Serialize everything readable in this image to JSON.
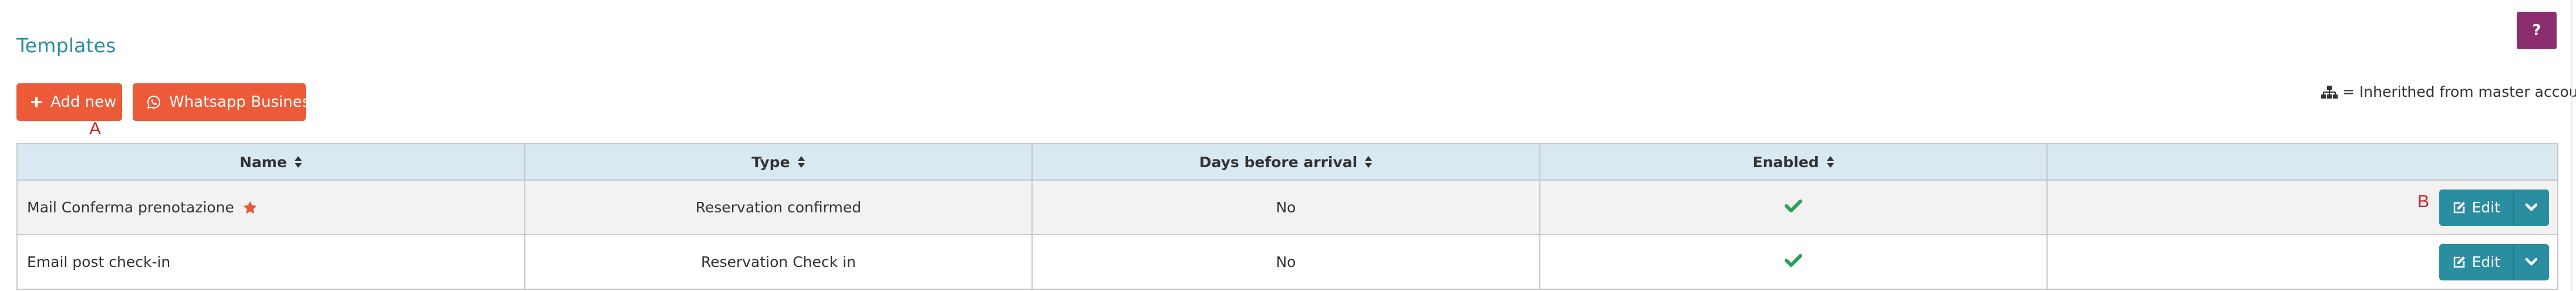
{
  "page": {
    "title": "Templates",
    "help_label": "?"
  },
  "toolbar": {
    "add_new_label": "Add new",
    "whatsapp_label": "Whatsapp Business"
  },
  "markers": {
    "a": "A",
    "b": "B"
  },
  "legend": {
    "text": "= Inherithed from master account",
    "icon": "sitemap-icon"
  },
  "table": {
    "headers": {
      "name": "Name",
      "type": "Type",
      "days": "Days before arrival",
      "enabled": "Enabled",
      "actions": ""
    },
    "rows": [
      {
        "name": "Mail Conferma prenotazione",
        "starred": true,
        "type": "Reservation confirmed",
        "days": "No",
        "enabled": true,
        "edit_label": "Edit"
      },
      {
        "name": "Email post check-in",
        "starred": false,
        "type": "Reservation Check in",
        "days": "No",
        "enabled": true,
        "edit_label": "Edit"
      }
    ]
  },
  "colors": {
    "title": "#2b8da0",
    "orange_button": "#ec5a38",
    "help_button": "#8b2d6f",
    "edit_button": "#2b8da0",
    "header_bg": "#d8e9f1",
    "check": "#2e9e5b",
    "star": "#e8593a",
    "marker": "#cc1f1f"
  }
}
